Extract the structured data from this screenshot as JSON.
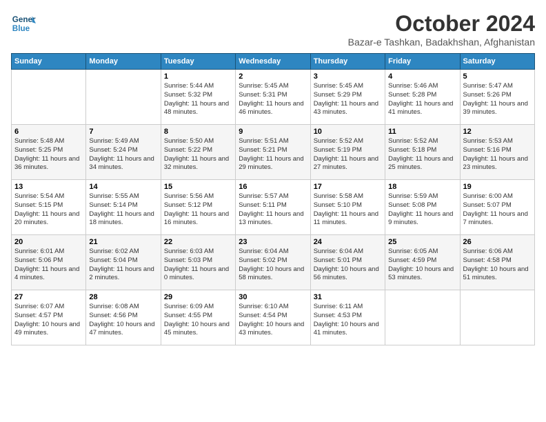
{
  "header": {
    "logo_line1": "General",
    "logo_line2": "Blue",
    "month": "October 2024",
    "location": "Bazar-e Tashkan, Badakhshan, Afghanistan"
  },
  "columns": [
    "Sunday",
    "Monday",
    "Tuesday",
    "Wednesday",
    "Thursday",
    "Friday",
    "Saturday"
  ],
  "weeks": [
    [
      {
        "day": "",
        "empty": true
      },
      {
        "day": "",
        "empty": true
      },
      {
        "day": "1",
        "sunrise": "Sunrise: 5:44 AM",
        "sunset": "Sunset: 5:32 PM",
        "daylight": "Daylight: 11 hours and 48 minutes."
      },
      {
        "day": "2",
        "sunrise": "Sunrise: 5:45 AM",
        "sunset": "Sunset: 5:31 PM",
        "daylight": "Daylight: 11 hours and 46 minutes."
      },
      {
        "day": "3",
        "sunrise": "Sunrise: 5:45 AM",
        "sunset": "Sunset: 5:29 PM",
        "daylight": "Daylight: 11 hours and 43 minutes."
      },
      {
        "day": "4",
        "sunrise": "Sunrise: 5:46 AM",
        "sunset": "Sunset: 5:28 PM",
        "daylight": "Daylight: 11 hours and 41 minutes."
      },
      {
        "day": "5",
        "sunrise": "Sunrise: 5:47 AM",
        "sunset": "Sunset: 5:26 PM",
        "daylight": "Daylight: 11 hours and 39 minutes."
      }
    ],
    [
      {
        "day": "6",
        "sunrise": "Sunrise: 5:48 AM",
        "sunset": "Sunset: 5:25 PM",
        "daylight": "Daylight: 11 hours and 36 minutes."
      },
      {
        "day": "7",
        "sunrise": "Sunrise: 5:49 AM",
        "sunset": "Sunset: 5:24 PM",
        "daylight": "Daylight: 11 hours and 34 minutes."
      },
      {
        "day": "8",
        "sunrise": "Sunrise: 5:50 AM",
        "sunset": "Sunset: 5:22 PM",
        "daylight": "Daylight: 11 hours and 32 minutes."
      },
      {
        "day": "9",
        "sunrise": "Sunrise: 5:51 AM",
        "sunset": "Sunset: 5:21 PM",
        "daylight": "Daylight: 11 hours and 29 minutes."
      },
      {
        "day": "10",
        "sunrise": "Sunrise: 5:52 AM",
        "sunset": "Sunset: 5:19 PM",
        "daylight": "Daylight: 11 hours and 27 minutes."
      },
      {
        "day": "11",
        "sunrise": "Sunrise: 5:52 AM",
        "sunset": "Sunset: 5:18 PM",
        "daylight": "Daylight: 11 hours and 25 minutes."
      },
      {
        "day": "12",
        "sunrise": "Sunrise: 5:53 AM",
        "sunset": "Sunset: 5:16 PM",
        "daylight": "Daylight: 11 hours and 23 minutes."
      }
    ],
    [
      {
        "day": "13",
        "sunrise": "Sunrise: 5:54 AM",
        "sunset": "Sunset: 5:15 PM",
        "daylight": "Daylight: 11 hours and 20 minutes."
      },
      {
        "day": "14",
        "sunrise": "Sunrise: 5:55 AM",
        "sunset": "Sunset: 5:14 PM",
        "daylight": "Daylight: 11 hours and 18 minutes."
      },
      {
        "day": "15",
        "sunrise": "Sunrise: 5:56 AM",
        "sunset": "Sunset: 5:12 PM",
        "daylight": "Daylight: 11 hours and 16 minutes."
      },
      {
        "day": "16",
        "sunrise": "Sunrise: 5:57 AM",
        "sunset": "Sunset: 5:11 PM",
        "daylight": "Daylight: 11 hours and 13 minutes."
      },
      {
        "day": "17",
        "sunrise": "Sunrise: 5:58 AM",
        "sunset": "Sunset: 5:10 PM",
        "daylight": "Daylight: 11 hours and 11 minutes."
      },
      {
        "day": "18",
        "sunrise": "Sunrise: 5:59 AM",
        "sunset": "Sunset: 5:08 PM",
        "daylight": "Daylight: 11 hours and 9 minutes."
      },
      {
        "day": "19",
        "sunrise": "Sunrise: 6:00 AM",
        "sunset": "Sunset: 5:07 PM",
        "daylight": "Daylight: 11 hours and 7 minutes."
      }
    ],
    [
      {
        "day": "20",
        "sunrise": "Sunrise: 6:01 AM",
        "sunset": "Sunset: 5:06 PM",
        "daylight": "Daylight: 11 hours and 4 minutes."
      },
      {
        "day": "21",
        "sunrise": "Sunrise: 6:02 AM",
        "sunset": "Sunset: 5:04 PM",
        "daylight": "Daylight: 11 hours and 2 minutes."
      },
      {
        "day": "22",
        "sunrise": "Sunrise: 6:03 AM",
        "sunset": "Sunset: 5:03 PM",
        "daylight": "Daylight: 11 hours and 0 minutes."
      },
      {
        "day": "23",
        "sunrise": "Sunrise: 6:04 AM",
        "sunset": "Sunset: 5:02 PM",
        "daylight": "Daylight: 10 hours and 58 minutes."
      },
      {
        "day": "24",
        "sunrise": "Sunrise: 6:04 AM",
        "sunset": "Sunset: 5:01 PM",
        "daylight": "Daylight: 10 hours and 56 minutes."
      },
      {
        "day": "25",
        "sunrise": "Sunrise: 6:05 AM",
        "sunset": "Sunset: 4:59 PM",
        "daylight": "Daylight: 10 hours and 53 minutes."
      },
      {
        "day": "26",
        "sunrise": "Sunrise: 6:06 AM",
        "sunset": "Sunset: 4:58 PM",
        "daylight": "Daylight: 10 hours and 51 minutes."
      }
    ],
    [
      {
        "day": "27",
        "sunrise": "Sunrise: 6:07 AM",
        "sunset": "Sunset: 4:57 PM",
        "daylight": "Daylight: 10 hours and 49 minutes."
      },
      {
        "day": "28",
        "sunrise": "Sunrise: 6:08 AM",
        "sunset": "Sunset: 4:56 PM",
        "daylight": "Daylight: 10 hours and 47 minutes."
      },
      {
        "day": "29",
        "sunrise": "Sunrise: 6:09 AM",
        "sunset": "Sunset: 4:55 PM",
        "daylight": "Daylight: 10 hours and 45 minutes."
      },
      {
        "day": "30",
        "sunrise": "Sunrise: 6:10 AM",
        "sunset": "Sunset: 4:54 PM",
        "daylight": "Daylight: 10 hours and 43 minutes."
      },
      {
        "day": "31",
        "sunrise": "Sunrise: 6:11 AM",
        "sunset": "Sunset: 4:53 PM",
        "daylight": "Daylight: 10 hours and 41 minutes."
      },
      {
        "day": "",
        "empty": true
      },
      {
        "day": "",
        "empty": true
      }
    ]
  ]
}
